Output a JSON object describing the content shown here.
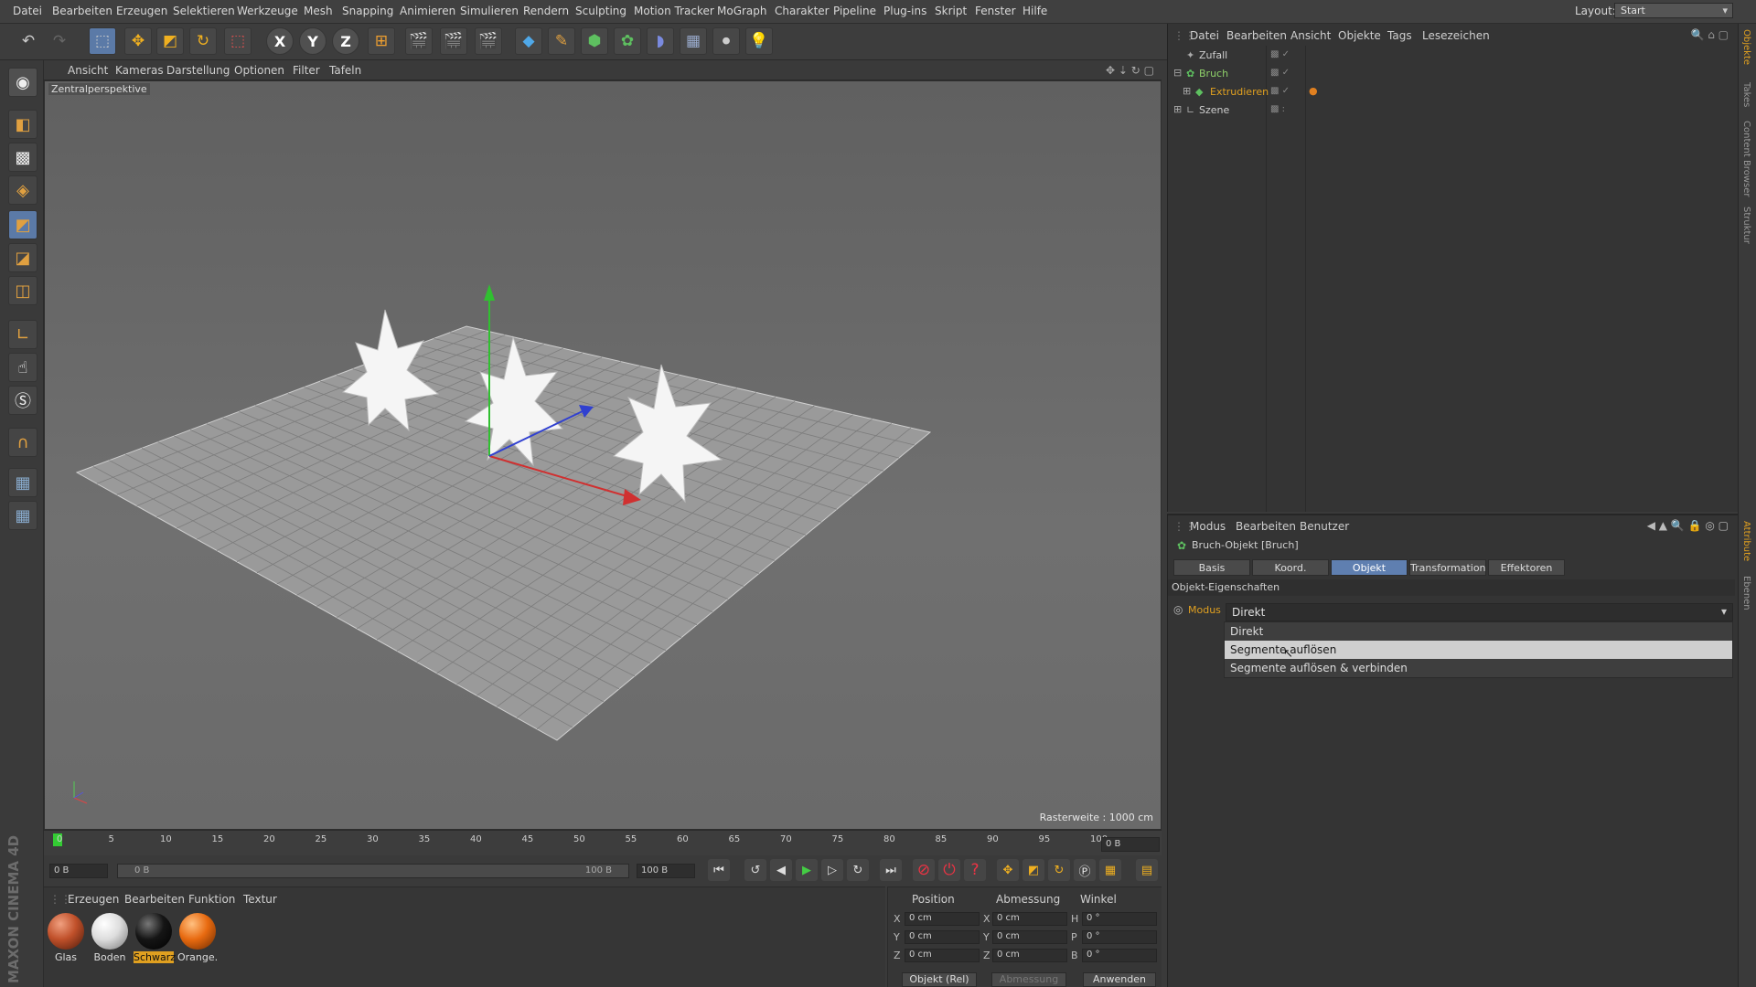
{
  "menu": [
    "Datei",
    "Bearbeiten",
    "Erzeugen",
    "Selektieren",
    "Werkzeuge",
    "Mesh",
    "Snapping",
    "Animieren",
    "Simulieren",
    "Rendern",
    "Sculpting",
    "Motion Tracker",
    "MoGraph",
    "Charakter",
    "Pipeline",
    "Plug-ins",
    "Skript",
    "Fenster",
    "Hilfe"
  ],
  "layout": {
    "label": "Layout:",
    "value": "Start"
  },
  "toolbar": {
    "axis_x": "X",
    "axis_y": "Y",
    "axis_z": "Z"
  },
  "viewport": {
    "menu": [
      "Ansicht",
      "Kameras",
      "Darstellung",
      "Optionen",
      "Filter",
      "Tafeln"
    ],
    "label": "Zentralperspektive",
    "raster": "Rasterweite : 1000 cm"
  },
  "timeline": {
    "ticks": [
      "0",
      "5",
      "10",
      "15",
      "20",
      "25",
      "30",
      "35",
      "40",
      "45",
      "50",
      "55",
      "60",
      "65",
      "70",
      "75",
      "80",
      "85",
      "90",
      "95",
      "100"
    ],
    "frame": "0 B",
    "start": "0 B",
    "range_start": "0 B",
    "range_end": "100 B",
    "end": "100 B"
  },
  "materials": {
    "menu": [
      "Erzeugen",
      "Bearbeiten",
      "Funktion",
      "Textur"
    ],
    "items": [
      {
        "label": "Glas",
        "color": "#c0502a"
      },
      {
        "label": "Boden",
        "color": "#e8e8e8"
      },
      {
        "label": "Schwarz",
        "color": "#151515"
      },
      {
        "label": "Orange.",
        "color": "#e86a10"
      }
    ]
  },
  "coords": {
    "headers": [
      "Position",
      "Abmessung",
      "Winkel"
    ],
    "rows": [
      {
        "a": "X",
        "p": "0 cm",
        "b": "X",
        "s": "0 cm",
        "c": "H",
        "r": "0 °"
      },
      {
        "a": "Y",
        "p": "0 cm",
        "b": "Y",
        "s": "0 cm",
        "c": "P",
        "r": "0 °"
      },
      {
        "a": "Z",
        "p": "0 cm",
        "b": "Z",
        "s": "0 cm",
        "c": "B",
        "r": "0 °"
      }
    ],
    "mode": "Objekt (Rel)",
    "size_mode": "Abmessung",
    "apply": "Anwenden"
  },
  "objects": {
    "menu": [
      "Datei",
      "Bearbeiten",
      "Ansicht",
      "Objekte",
      "Tags",
      "Lesezeichen"
    ],
    "items": [
      {
        "name": "Zufall",
        "color": "#cfcfcf"
      },
      {
        "name": "Bruch",
        "color": "#8fd06a"
      },
      {
        "name": "Extrudieren",
        "color": "#e0a020"
      },
      {
        "name": "Szene",
        "color": "#cfcfcf"
      }
    ]
  },
  "attributes": {
    "menu": [
      "Modus",
      "Bearbeiten",
      "Benutzer"
    ],
    "title": "Bruch-Objekt [Bruch]",
    "tabs": [
      "Basis",
      "Koord.",
      "Objekt",
      "Transformation",
      "Effektoren"
    ],
    "section": "Objekt-Eigenschaften",
    "field_label": "Modus",
    "field_value": "Direkt",
    "options": [
      "Direkt",
      "Segmente auflösen",
      "Segmente auflösen & verbinden"
    ]
  },
  "side_tabs": [
    "Objekte",
    "Takes",
    "Content Browser",
    "Struktur",
    "Attribute",
    "Ebenen"
  ]
}
